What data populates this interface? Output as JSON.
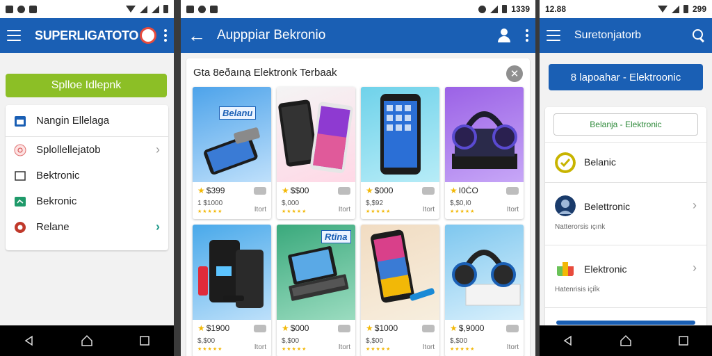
{
  "screen1": {
    "status": {
      "icons": [
        "gallery-icon",
        "settings-icon",
        "image-icon"
      ]
    },
    "appbar": {
      "title": "SUPERLIGATOTO"
    },
    "green_button": "Splloe Idlepnk",
    "menu": [
      {
        "label": "Nangin Ellelaga",
        "icon": "calendar-icon",
        "chevron": false
      },
      {
        "label": "Splollellejatob",
        "icon": "shop-icon",
        "chevron": true
      },
      {
        "label": "Bektronic",
        "icon": "square-icon",
        "chevron": false
      },
      {
        "label": "Bekronic",
        "icon": "green-box-icon",
        "chevron": false
      },
      {
        "label": "Relane",
        "icon": "gear-icon",
        "chevron": true
      }
    ]
  },
  "screen2": {
    "status": {
      "time": "1339"
    },
    "appbar": {
      "title": "Aupppiar Bekronio"
    },
    "panel_title": "Gta 8eðaınạ Elektronk Terbaak",
    "products": [
      {
        "price": "$399",
        "sub": "1 $1000",
        "sold": "Itort",
        "img_label": "Belanu",
        "bg": [
          "#4da3ea",
          "#bfe0fb"
        ],
        "kind": "phone-flat"
      },
      {
        "price": "$$00",
        "sub": "$,000",
        "sold": "Itort",
        "img_label": "",
        "bg": [
          "#f4f4f4",
          "#ffd8e6"
        ],
        "kind": "phones"
      },
      {
        "price": "$000",
        "sub": "$,$92",
        "sold": "Itort",
        "img_label": "",
        "bg": [
          "#6fd2ea",
          "#b7ecf7"
        ],
        "kind": "phone"
      },
      {
        "price": "I0ĊO",
        "sub": "$,$0,I0",
        "sold": "Itort",
        "img_label": "",
        "bg": [
          "#9b62e6",
          "#c7a7f7"
        ],
        "kind": "headphones"
      },
      {
        "price": "$1900",
        "sub": "$,$00",
        "sold": "Itort",
        "img_label": "",
        "bg": [
          "#49a9ea",
          "#bde0fa"
        ],
        "kind": "devices"
      },
      {
        "price": "$000",
        "sub": "$,$00",
        "sold": "Itort",
        "img_label": "Rtīna",
        "bg": [
          "#3aa97c",
          "#9bdcc0"
        ],
        "kind": "laptop"
      },
      {
        "price": "$1000",
        "sub": "$,$00",
        "sold": "Itort",
        "img_label": "",
        "bg": [
          "#f1dcc2",
          "#f7eede"
        ],
        "kind": "phone-colorful"
      },
      {
        "price": "$,9000",
        "sub": "$,$00",
        "sold": "Itort",
        "img_label": "",
        "bg": [
          "#7ec7ef",
          "#d9f0fc"
        ],
        "kind": "headphones-box"
      }
    ]
  },
  "screen3": {
    "status": {
      "time": "12.88",
      "right_time": "299"
    },
    "appbar": {
      "title": "Suretonjatorb"
    },
    "blue_button": "8 lapoahar - Elektroonic",
    "chip": "Belanja - Elektronic",
    "rows": [
      {
        "label": "Belanic",
        "sub": "",
        "icon": "check-icon",
        "chevron": false
      },
      {
        "label": "Belettronic",
        "sub": "Natterorsis ıçınk",
        "icon": "avatar-icon",
        "chevron": true
      },
      {
        "label": "Elektronic",
        "sub": "Hatenrisis içiİk",
        "icon": "shopping-bag-icon",
        "chevron": true
      }
    ]
  },
  "colors": {
    "appbar": "#1a5fb4",
    "green": "#8cbf26",
    "star": "#f2b807"
  }
}
